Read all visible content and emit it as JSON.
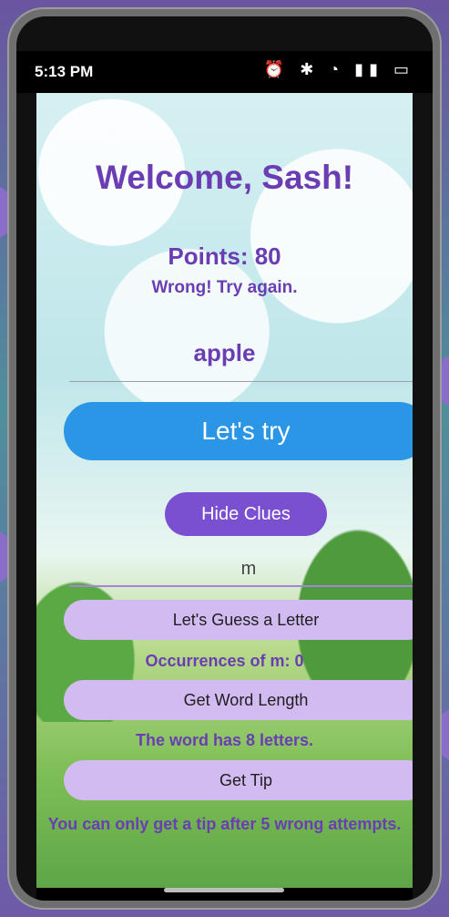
{
  "status_bar": {
    "time": "5:13 PM",
    "icons": "⏰ ✱ ◔ ▮▮ ▭"
  },
  "header": {
    "title": "Welcome, Sash!"
  },
  "game": {
    "points": "Points: 80",
    "feedback": "Wrong! Try again.",
    "guess_value": "apple",
    "lets_try_label": "Let's try",
    "hide_clues_label": "Hide Clues",
    "letter_value": "m",
    "guess_letter_label": "Let's Guess a Letter",
    "occurrences_text": "Occurrences of m: 0",
    "word_length_label": "Get Word Length",
    "word_length_text": "The word has 8 letters.",
    "tip_label": "Get Tip",
    "tip_text": "You can only get a tip after 5 wrong attempts."
  },
  "colors": {
    "accent_purple": "#6a3eb2",
    "primary_blue": "#2b95e6",
    "button_purple": "#7a4fd0",
    "pill_lavender": "#d1bbf0"
  }
}
